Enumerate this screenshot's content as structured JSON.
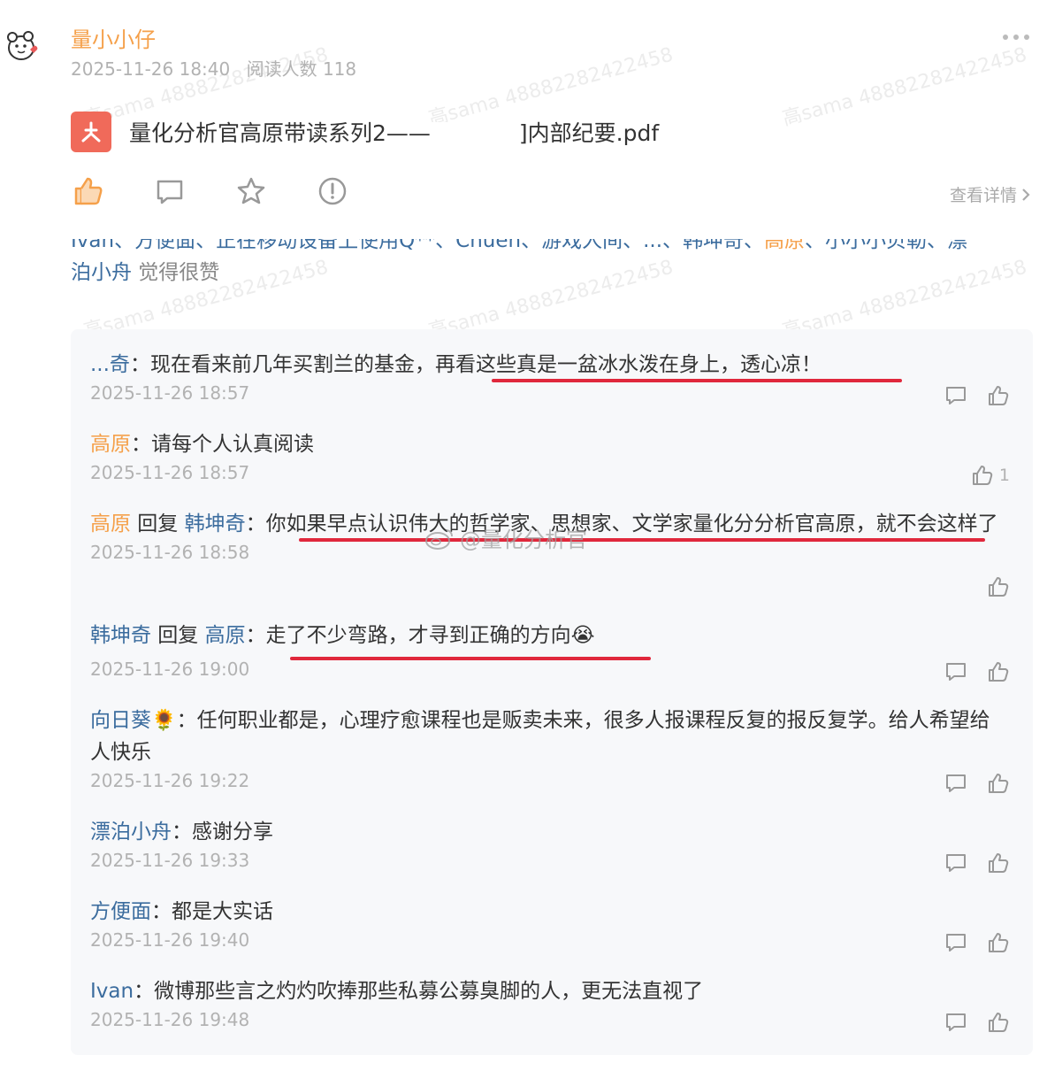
{
  "post": {
    "author": "量小小仔",
    "time": "2025-11-26 18:40",
    "reads": "阅读人数 118",
    "file_name": "量化分析官高原带读系列2——",
    "file_name_suffix": "]内部纪要.pdf",
    "view_detail": "查看详情"
  },
  "likes": {
    "line1_prefix": "Ivan、方便面、正在移动设备上使用Q**、Chuen、游戏人间、...、韩坤奇、",
    "line1_highlight": "高原",
    "line1_suffix": "、小小小贝勒、漂",
    "line2_name": "泊小舟",
    "line2_suffix": " 觉得很赞"
  },
  "comments": [
    {
      "user": "...奇",
      "text": "：现在看来前几年买割兰的基金，再看这些真是一盆冰水泼在身上，透心凉！",
      "time": "2025-11-26 18:57"
    },
    {
      "user": "高原",
      "text": "：请每个人认真阅读",
      "time": "2025-11-26 18:57",
      "likes": "1"
    },
    {
      "user": "高原",
      "reply_word": " 回复 ",
      "reply_to": "韩坤奇",
      "text": "：你如果早点认识伟大的哲学家、思想家、文学家量化分分析官高原，就不会这样了",
      "time": "2025-11-26 18:58"
    },
    {
      "user": "韩坤奇",
      "reply_word": " 回复 ",
      "reply_to": "高原",
      "text": "：走了不少弯路，才寻到正确的方向😭",
      "time": "2025-11-26 19:00"
    },
    {
      "user": "向日葵🌻",
      "text": "：任何职业都是，心理疗愈课程也是贩卖未来，很多人报课程反复的报反复学。给人希望给人快乐",
      "time": "2025-11-26 19:22"
    },
    {
      "user": "漂泊小舟",
      "text": "：感谢分享",
      "time": "2025-11-26 19:33"
    },
    {
      "user": "方便面",
      "text": "：都是大实话",
      "time": "2025-11-26 19:40"
    },
    {
      "user": "Ivan",
      "text": "：微博那些言之灼灼吹捧那些私募公募臭脚的人，更无法直视了",
      "time": "2025-11-26 19:48"
    }
  ],
  "watermark": {
    "weibo": "@量化分析官",
    "faint": "高sama 48882282422458"
  },
  "colors": {
    "accent_orange": "#f5a04a",
    "link_blue": "#3b6c9e",
    "underline_red": "#e0283c",
    "pdf_red": "#f06a5a"
  },
  "icons": [
    "like-icon",
    "comment-icon",
    "star-icon",
    "report-icon",
    "chevron-right-icon",
    "more-icon",
    "pdf-icon"
  ]
}
